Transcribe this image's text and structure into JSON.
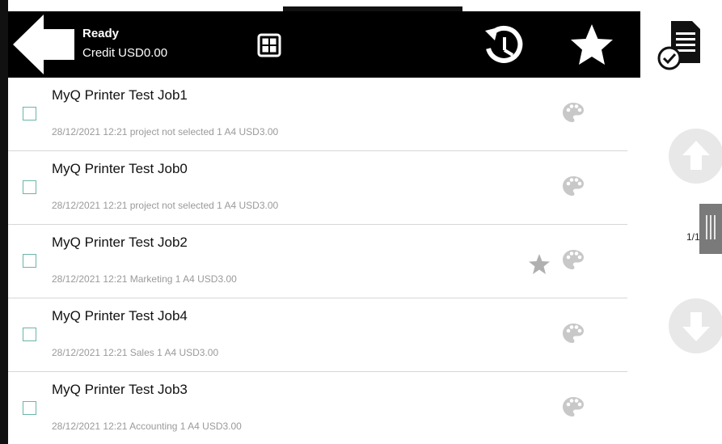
{
  "header": {
    "status_title": "Ready",
    "credit_text": "Credit USD0.00",
    "icons": {
      "back": "back-arrow-icon",
      "apps": "grid-icon",
      "history": "history-clock-icon",
      "favorites": "star-icon",
      "jobs": "document-check-icon"
    },
    "background_color": "#000000"
  },
  "jobs": [
    {
      "name": "MyQ Printer Test Job1",
      "meta": "28/12/2021 12:21 project not selected 1 A4 USD3.00",
      "favorite": false
    },
    {
      "name": "MyQ Printer Test Job0",
      "meta": "28/12/2021 12:21 project not selected 1 A4 USD3.00",
      "favorite": false
    },
    {
      "name": "MyQ Printer Test Job2",
      "meta": "28/12/2021 12:21 Marketing 1 A4 USD3.00",
      "favorite": true
    },
    {
      "name": "MyQ Printer Test Job4",
      "meta": "28/12/2021 12:21 Sales 1 A4 USD3.00",
      "favorite": false
    },
    {
      "name": "MyQ Printer Test Job3",
      "meta": "28/12/2021 12:21 Accounting 1 A4 USD3.00",
      "favorite": false
    }
  ],
  "pagination": {
    "page_text": "1/1"
  },
  "colors": {
    "checkbox_border": "#6bb5a8",
    "meta_text": "#9a9a9a",
    "icon_gray": "#c8c8c8",
    "scroll_button": "#e8e8e8"
  }
}
